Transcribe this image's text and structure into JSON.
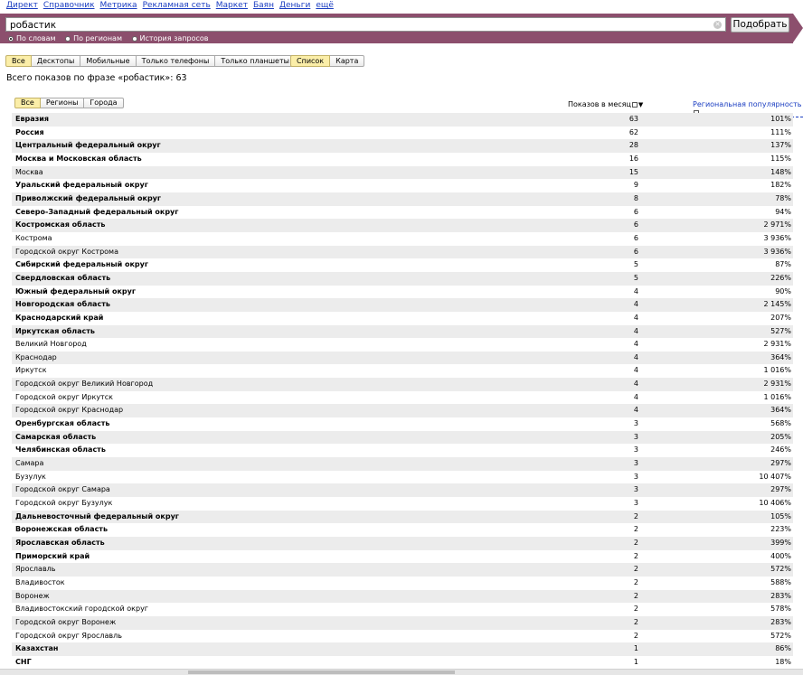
{
  "topnav": [
    "Директ",
    "Справочник",
    "Метрика",
    "Рекламная сеть",
    "Маркет",
    "Баян",
    "Деньги",
    "ещё"
  ],
  "search": {
    "query": "робастик",
    "clear_icon": "close-icon",
    "submit_label": "Подобрать"
  },
  "modes": [
    {
      "label": "По словам",
      "selected": true
    },
    {
      "label": "По регионам",
      "selected": false
    },
    {
      "label": "История запросов",
      "selected": false
    }
  ],
  "device_tabs": [
    {
      "label": "Все",
      "active": true
    },
    {
      "label": "Десктопы",
      "active": false
    },
    {
      "label": "Мобильные",
      "active": false
    },
    {
      "label": "Только телефоны",
      "active": false
    },
    {
      "label": "Только планшеты",
      "active": false
    }
  ],
  "view_tabs": [
    {
      "label": "Список",
      "active": true
    },
    {
      "label": "Карта",
      "active": false
    }
  ],
  "total_text": "Всего показов по фразе «робастик»: 63",
  "region_tabs": [
    {
      "label": "Все",
      "active": true
    },
    {
      "label": "Регионы",
      "active": false
    },
    {
      "label": "Города",
      "active": false
    }
  ],
  "columns": {
    "shows": "Показов в месяц",
    "popularity": "Региональная популярность"
  },
  "rows": [
    {
      "name": "Евразия",
      "shows": "63",
      "pop": "101%",
      "bold": true
    },
    {
      "name": "Россия",
      "shows": "62",
      "pop": "111%",
      "bold": true
    },
    {
      "name": "Центральный федеральный округ",
      "shows": "28",
      "pop": "137%",
      "bold": true
    },
    {
      "name": "Москва и Московская область",
      "shows": "16",
      "pop": "115%",
      "bold": true
    },
    {
      "name": "Москва",
      "shows": "15",
      "pop": "148%",
      "bold": false
    },
    {
      "name": "Уральский федеральный округ",
      "shows": "9",
      "pop": "182%",
      "bold": true
    },
    {
      "name": "Приволжский федеральный округ",
      "shows": "8",
      "pop": "78%",
      "bold": true
    },
    {
      "name": "Северо-Западный федеральный округ",
      "shows": "6",
      "pop": "94%",
      "bold": true
    },
    {
      "name": "Костромская область",
      "shows": "6",
      "pop": "2 971%",
      "bold": true
    },
    {
      "name": "Кострома",
      "shows": "6",
      "pop": "3 936%",
      "bold": false
    },
    {
      "name": "Городской округ Кострома",
      "shows": "6",
      "pop": "3 936%",
      "bold": false
    },
    {
      "name": "Сибирский федеральный округ",
      "shows": "5",
      "pop": "87%",
      "bold": true
    },
    {
      "name": "Свердловская область",
      "shows": "5",
      "pop": "226%",
      "bold": true
    },
    {
      "name": "Южный федеральный округ",
      "shows": "4",
      "pop": "90%",
      "bold": true
    },
    {
      "name": "Новгородская область",
      "shows": "4",
      "pop": "2 145%",
      "bold": true
    },
    {
      "name": "Краснодарский край",
      "shows": "4",
      "pop": "207%",
      "bold": true
    },
    {
      "name": "Иркутская область",
      "shows": "4",
      "pop": "527%",
      "bold": true
    },
    {
      "name": "Великий Новгород",
      "shows": "4",
      "pop": "2 931%",
      "bold": false
    },
    {
      "name": "Краснодар",
      "shows": "4",
      "pop": "364%",
      "bold": false
    },
    {
      "name": "Иркутск",
      "shows": "4",
      "pop": "1 016%",
      "bold": false
    },
    {
      "name": "Городской округ Великий Новгород",
      "shows": "4",
      "pop": "2 931%",
      "bold": false
    },
    {
      "name": "Городской округ Иркутск",
      "shows": "4",
      "pop": "1 016%",
      "bold": false
    },
    {
      "name": "Городской округ Краснодар",
      "shows": "4",
      "pop": "364%",
      "bold": false
    },
    {
      "name": "Оренбургская область",
      "shows": "3",
      "pop": "568%",
      "bold": true
    },
    {
      "name": "Самарская область",
      "shows": "3",
      "pop": "205%",
      "bold": true
    },
    {
      "name": "Челябинская область",
      "shows": "3",
      "pop": "246%",
      "bold": true
    },
    {
      "name": "Самара",
      "shows": "3",
      "pop": "297%",
      "bold": false
    },
    {
      "name": "Бузулук",
      "shows": "3",
      "pop": "10 407%",
      "bold": false
    },
    {
      "name": "Городской округ Самара",
      "shows": "3",
      "pop": "297%",
      "bold": false
    },
    {
      "name": "Городской округ Бузулук",
      "shows": "3",
      "pop": "10 406%",
      "bold": false
    },
    {
      "name": "Дальневосточный федеральный округ",
      "shows": "2",
      "pop": "105%",
      "bold": true
    },
    {
      "name": "Воронежская область",
      "shows": "2",
      "pop": "223%",
      "bold": true
    },
    {
      "name": "Ярославская область",
      "shows": "2",
      "pop": "399%",
      "bold": true
    },
    {
      "name": "Приморский край",
      "shows": "2",
      "pop": "400%",
      "bold": true
    },
    {
      "name": "Ярославль",
      "shows": "2",
      "pop": "572%",
      "bold": false
    },
    {
      "name": "Владивосток",
      "shows": "2",
      "pop": "588%",
      "bold": false
    },
    {
      "name": "Воронеж",
      "shows": "2",
      "pop": "283%",
      "bold": false
    },
    {
      "name": "Владивостокский городской округ",
      "shows": "2",
      "pop": "578%",
      "bold": false
    },
    {
      "name": "Городской округ Воронеж",
      "shows": "2",
      "pop": "283%",
      "bold": false
    },
    {
      "name": "Городской округ Ярославль",
      "shows": "2",
      "pop": "572%",
      "bold": false
    },
    {
      "name": "Казахстан",
      "shows": "1",
      "pop": "86%",
      "bold": true
    },
    {
      "name": "СНГ",
      "shows": "1",
      "pop": "18%",
      "bold": true
    }
  ],
  "colors": {
    "band": "#8c4f6d",
    "link": "#1a3dc1",
    "tab_active": "#fbeea8",
    "row_alt": "#ececec"
  }
}
